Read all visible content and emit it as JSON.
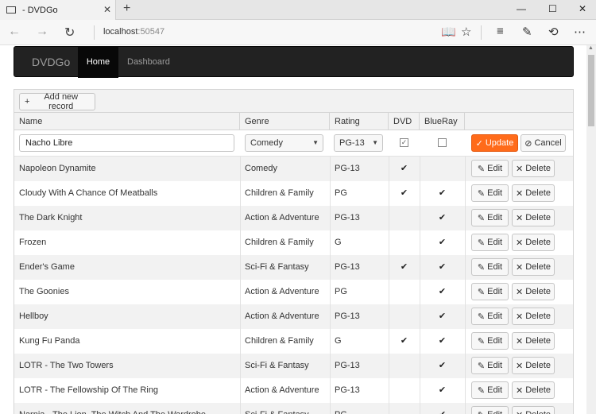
{
  "browser": {
    "tab_title": "- DVDGo",
    "new_tab": "+",
    "close_tab": "✕",
    "url_host": "localhost",
    "url_port": ":50547",
    "win_min": "—",
    "win_max": "☐",
    "win_close": "✕"
  },
  "app": {
    "brand": "DVDGo",
    "nav": [
      {
        "label": "Home",
        "active": true
      },
      {
        "label": "Dashboard",
        "active": false
      }
    ]
  },
  "grid": {
    "add_label": "Add new record",
    "columns": [
      "Name",
      "Genre",
      "Rating",
      "DVD",
      "BlueRay"
    ],
    "edit_row": {
      "name": "Nacho Libre",
      "genre": "Comedy",
      "rating": "PG-13",
      "dvd": true,
      "blueray": false,
      "update_label": "Update",
      "cancel_label": "Cancel"
    },
    "edit_label": "Edit",
    "delete_label": "Delete",
    "rows": [
      {
        "name": "Napoleon Dynamite",
        "genre": "Comedy",
        "rating": "PG-13",
        "dvd": "✔",
        "blueray": ""
      },
      {
        "name": "Cloudy With A Chance Of Meatballs",
        "genre": "Children & Family",
        "rating": "PG",
        "dvd": "✔",
        "blueray": "✔"
      },
      {
        "name": "The Dark Knight",
        "genre": "Action & Adventure",
        "rating": "PG-13",
        "dvd": "",
        "blueray": "✔"
      },
      {
        "name": "Frozen",
        "genre": "Children & Family",
        "rating": "G",
        "dvd": "",
        "blueray": "✔"
      },
      {
        "name": "Ender's Game",
        "genre": "Sci-Fi & Fantasy",
        "rating": "PG-13",
        "dvd": "✔",
        "blueray": "✔"
      },
      {
        "name": "The Goonies",
        "genre": "Action & Adventure",
        "rating": "PG",
        "dvd": "",
        "blueray": "✔"
      },
      {
        "name": "Hellboy",
        "genre": "Action & Adventure",
        "rating": "PG-13",
        "dvd": "",
        "blueray": "✔"
      },
      {
        "name": "Kung Fu Panda",
        "genre": "Children & Family",
        "rating": "G",
        "dvd": "✔",
        "blueray": "✔"
      },
      {
        "name": "LOTR - The Two Towers",
        "genre": "Sci-Fi & Fantasy",
        "rating": "PG-13",
        "dvd": "",
        "blueray": "✔"
      },
      {
        "name": "LOTR - The Fellowship Of The Ring",
        "genre": "Action & Adventure",
        "rating": "PG-13",
        "dvd": "",
        "blueray": "✔"
      },
      {
        "name": "Narnia - The Lion, The Witch And The Wardrobe",
        "genre": "Sci-Fi & Fantasy",
        "rating": "PG",
        "dvd": "",
        "blueray": "✔"
      }
    ]
  },
  "colors": {
    "accent": "#ff6b1a",
    "navbar": "#222222"
  }
}
